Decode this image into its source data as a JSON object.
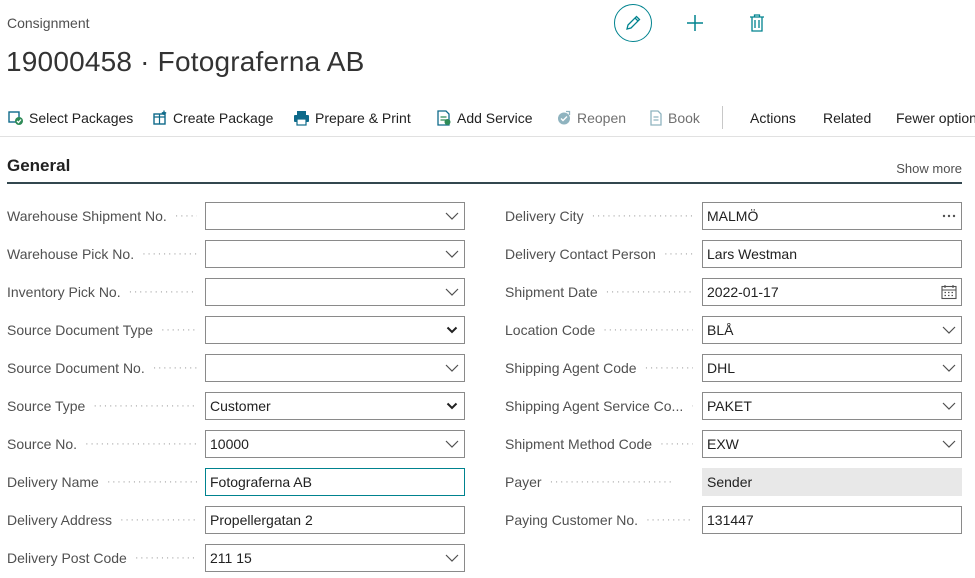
{
  "header": {
    "caption": "Consignment",
    "title": "19000458 · Fotograferna AB"
  },
  "toolbar": {
    "items": [
      {
        "label": "Select Packages",
        "icon": "select-packages-icon"
      },
      {
        "label": "Create Package",
        "icon": "create-package-icon"
      },
      {
        "label": "Prepare & Print",
        "icon": "printer-icon"
      },
      {
        "label": "Add Service",
        "icon": "add-service-icon"
      },
      {
        "label": "Reopen",
        "icon": "reopen-icon"
      },
      {
        "label": "Book",
        "icon": "book-icon"
      },
      {
        "label": "Actions"
      },
      {
        "label": "Related"
      },
      {
        "label": "Fewer options"
      }
    ]
  },
  "section": {
    "title": "General",
    "show_more": "Show more"
  },
  "left_fields": [
    {
      "label": "Warehouse Shipment No.",
      "value": "",
      "control": "chevron"
    },
    {
      "label": "Warehouse Pick No.",
      "value": "",
      "control": "chevron"
    },
    {
      "label": "Inventory Pick No.",
      "value": "",
      "control": "chevron"
    },
    {
      "label": "Source Document Type",
      "value": "",
      "control": "select"
    },
    {
      "label": "Source Document No.",
      "value": "",
      "control": "chevron"
    },
    {
      "label": "Source Type",
      "value": "Customer",
      "control": "select"
    },
    {
      "label": "Source No.",
      "value": "10000",
      "control": "chevron"
    },
    {
      "label": "Delivery Name",
      "value": "Fotograferna AB",
      "control": "none"
    },
    {
      "label": "Delivery Address",
      "value": "Propellergatan 2",
      "control": "none"
    },
    {
      "label": "Delivery Post Code",
      "value": "211 15",
      "control": "chevron"
    }
  ],
  "right_fields": [
    {
      "label": "Delivery City",
      "value": "MALMÖ",
      "control": "ellipsis"
    },
    {
      "label": "Delivery Contact Person",
      "value": "Lars Westman",
      "control": "none"
    },
    {
      "label": "Shipment Date",
      "value": "2022-01-17",
      "control": "calendar"
    },
    {
      "label": "Location Code",
      "value": "BLÅ",
      "control": "chevron"
    },
    {
      "label": "Shipping Agent Code",
      "value": "DHL",
      "control": "chevron"
    },
    {
      "label": "Shipping Agent Service Co...",
      "value": "PAKET",
      "control": "chevron"
    },
    {
      "label": "Shipment Method Code",
      "value": "EXW",
      "control": "chevron"
    },
    {
      "label": "Payer",
      "value": "Sender",
      "control": "none"
    },
    {
      "label": "Paying Customer No.",
      "value": "131447",
      "control": "none"
    }
  ],
  "colors": {
    "accent": "#00838f",
    "section_rule": "#33474f",
    "readonly_bg": "#e8e8e8"
  }
}
